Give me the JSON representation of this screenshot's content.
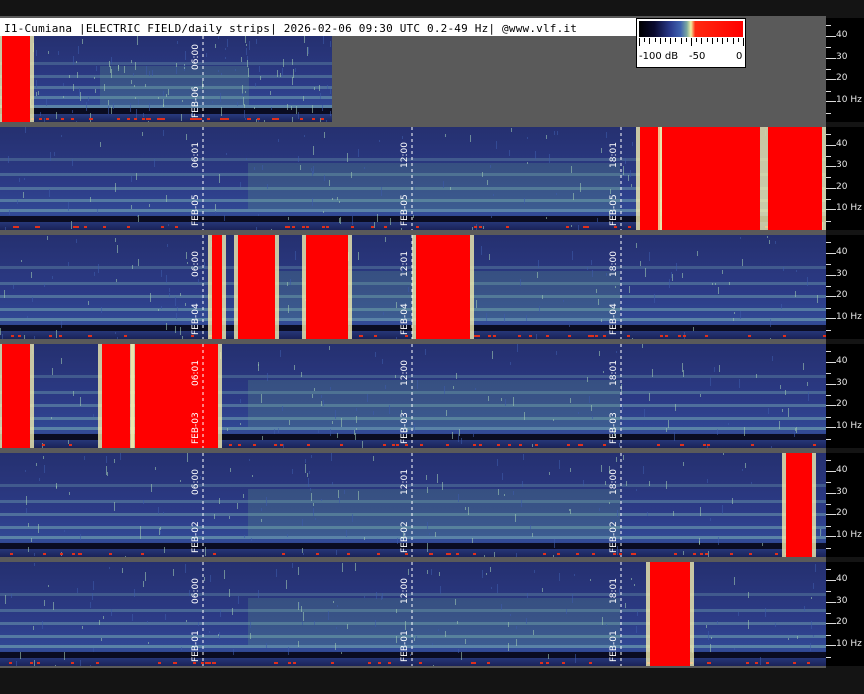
{
  "header": {
    "title": "I1-Cumiana |ELECTRIC FIELD/daily strips| 2026-02-06 09:30 UTC 0.2-49 Hz| @www.vlf.it"
  },
  "colorbar": {
    "min_label": "-100 dB",
    "mid_label": "-50",
    "max_label": "0"
  },
  "frequency_axis": [
    "40",
    "30",
    "20",
    "10 Hz"
  ],
  "strips": [
    {
      "date": "FEB-06",
      "time_labels": [
        "06:00"
      ]
    },
    {
      "date": "FEB-05",
      "time_labels": [
        "06:01",
        "12:00",
        "18:01"
      ]
    },
    {
      "date": "FEB-04",
      "time_labels": [
        "06:00",
        "12:01",
        "18:00"
      ]
    },
    {
      "date": "FEB-03",
      "time_labels": [
        "06:01",
        "12:00",
        "18:01"
      ]
    },
    {
      "date": "FEB-02",
      "time_labels": [
        "06:00",
        "12:01",
        "18:00"
      ]
    },
    {
      "date": "FEB-01",
      "time_labels": [
        "06:00",
        "12:00",
        "18:01"
      ]
    }
  ],
  "colors": {
    "background": "#5a5a5a",
    "spectrogram_base": "#27337a",
    "saturation": "#ff0000"
  }
}
